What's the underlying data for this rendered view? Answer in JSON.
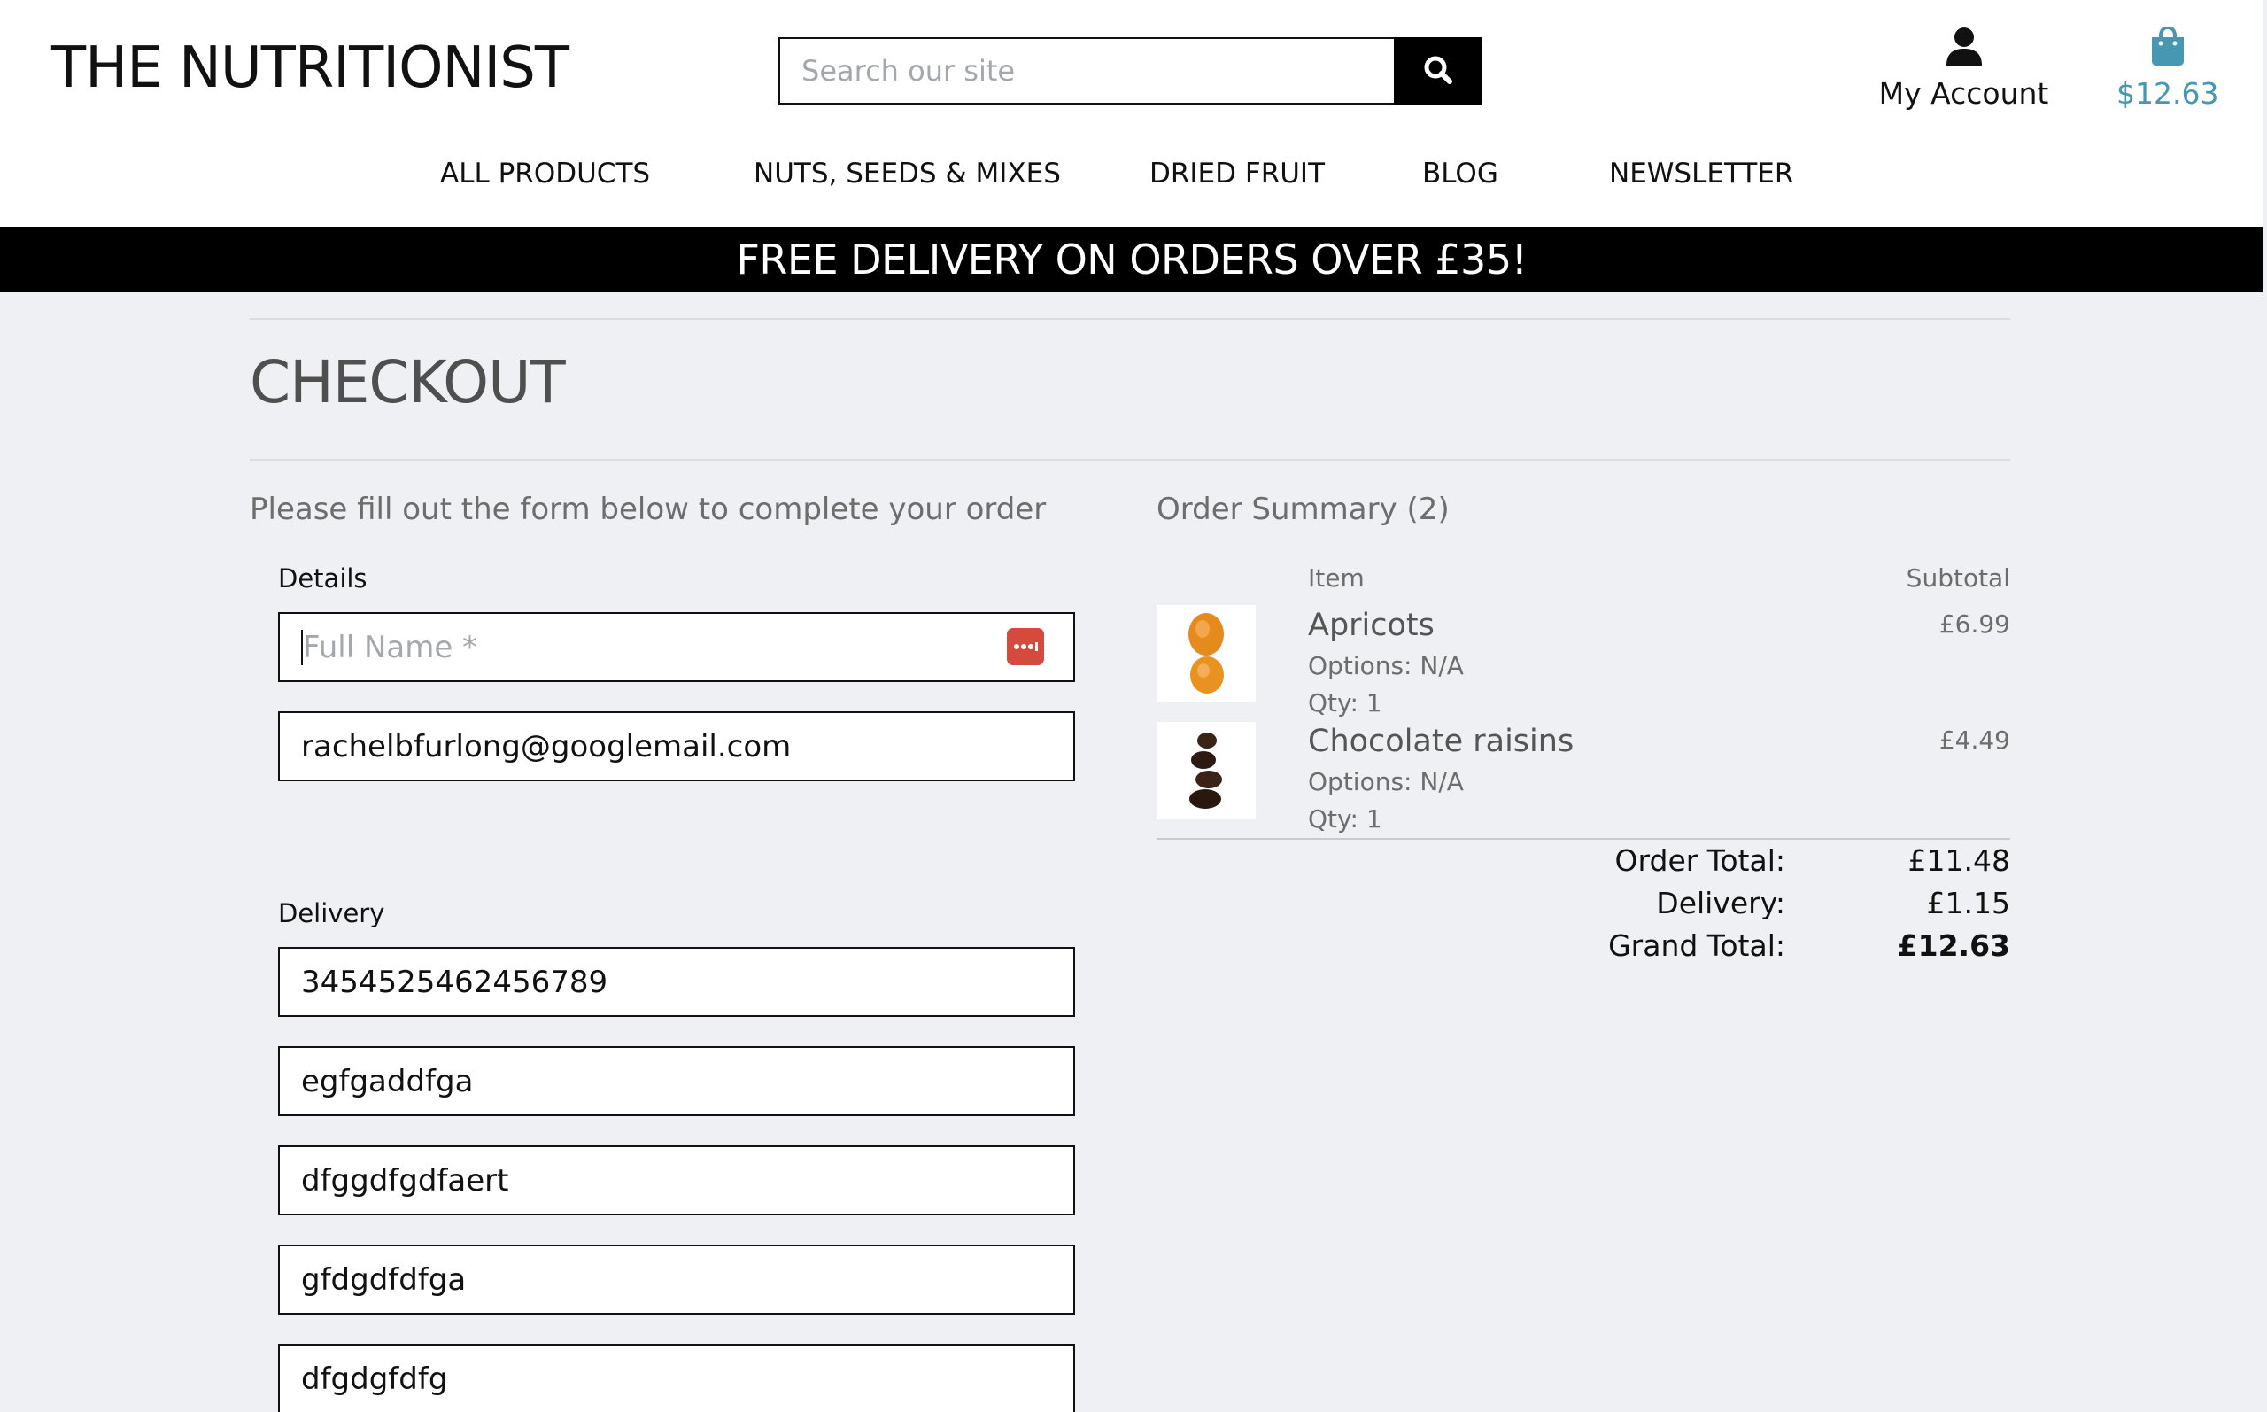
{
  "header": {
    "brand": "THE NUTRITIONIST",
    "search_placeholder": "Search our site",
    "account_label": "My Account",
    "bag_total": "$12.63"
  },
  "nav": {
    "items": [
      "ALL PRODUCTS",
      "NUTS, SEEDS & MIXES",
      "DRIED FRUIT",
      "BLOG",
      "NEWSLETTER"
    ]
  },
  "banner": {
    "text": "FREE DELIVERY ON ORDERS OVER £35!"
  },
  "page": {
    "title": "CHECKOUT",
    "form_intro": "Please fill out the form below to complete your order"
  },
  "details": {
    "legend": "Details",
    "full_name_placeholder": "Full Name *",
    "full_name_value": "",
    "email_value": "rachelbfurlong@googlemail.com"
  },
  "delivery": {
    "legend": "Delivery",
    "fields": [
      "3454525462456789",
      "egfgaddfga",
      "dfggdfgdfaert",
      "gfdgdfdfga",
      "dfgdgfdfg"
    ]
  },
  "summary": {
    "title": "Order Summary (2)",
    "col_item": "Item",
    "col_subtotal": "Subtotal",
    "items": [
      {
        "name": "Apricots",
        "options": "Options: N/A",
        "qty": "Qty: 1",
        "price": "£6.99"
      },
      {
        "name": "Chocolate raisins",
        "options": "Options: N/A",
        "qty": "Qty: 1",
        "price": "£4.49"
      }
    ],
    "order_total_label": "Order Total:",
    "order_total": "£11.48",
    "delivery_label": "Delivery:",
    "delivery": "£1.15",
    "grand_total_label": "Grand Total:",
    "grand_total": "£12.63"
  },
  "colors": {
    "banner_bg": "#000000",
    "accent_bag": "#4797b3",
    "page_bg": "#eff0f4",
    "password_badge": "#d44a3c"
  }
}
